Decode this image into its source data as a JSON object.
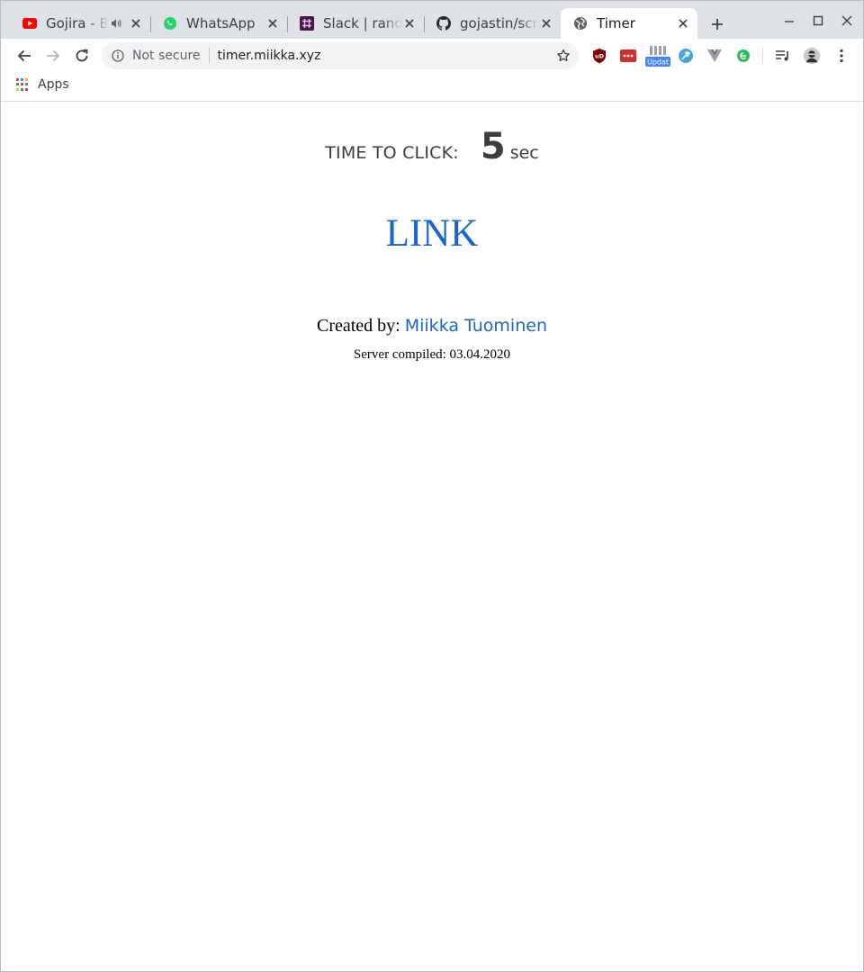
{
  "browser": {
    "tabs": [
      {
        "title": "Gojira - B",
        "favicon": "youtube-icon",
        "audio": true,
        "active": false
      },
      {
        "title": "WhatsApp",
        "favicon": "whatsapp-icon",
        "audio": false,
        "active": false
      },
      {
        "title": "Slack | rando",
        "favicon": "slack-icon",
        "audio": false,
        "active": false
      },
      {
        "title": "gojastin/scre",
        "favicon": "github-icon",
        "audio": false,
        "active": false
      },
      {
        "title": "Timer",
        "favicon": "globe-icon",
        "audio": false,
        "active": true
      }
    ],
    "omnibox": {
      "security_label": "Not secure",
      "url": "timer.miikka.xyz"
    },
    "extensions": {
      "update_badge": "Updat"
    },
    "bookmarks": {
      "apps_label": "Apps"
    }
  },
  "page": {
    "timer_label": "TIME TO CLICK:",
    "timer_value": "5",
    "timer_unit": "sec",
    "link_label": "LINK",
    "created_by_label": "Created by:",
    "author_name": "Miikka Tuominen",
    "compiled_text": "Server compiled: 03.04.2020"
  },
  "colors": {
    "link": "#1a66cc",
    "timer_text": "#3d3d3d",
    "tabstrip_bg": "#dee1e6",
    "youtube_red": "#ff0000",
    "whatsapp_green": "#25d366",
    "slack_purple": "#4a154b"
  }
}
